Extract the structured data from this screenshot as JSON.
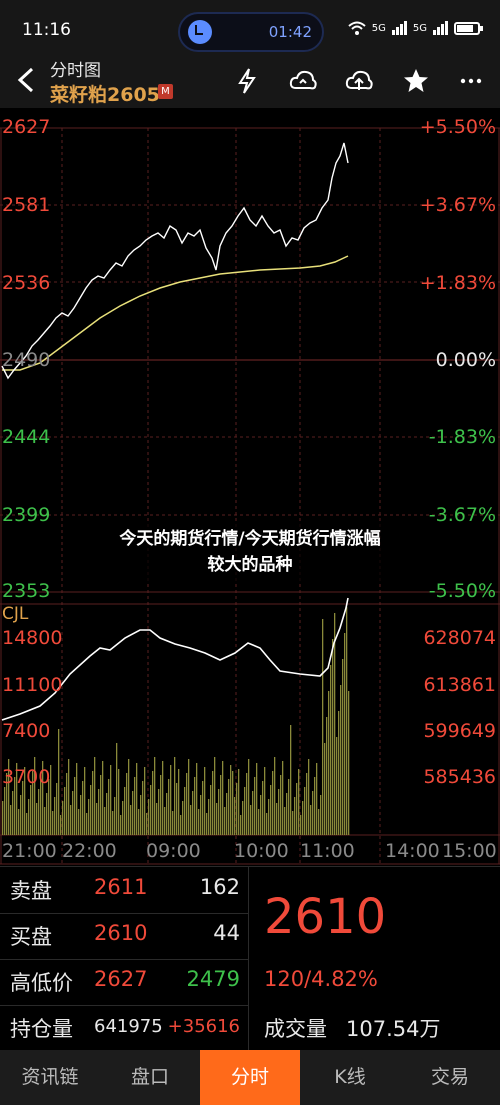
{
  "status_bar": {
    "time": "11:16",
    "timer": "01:42",
    "net1": "5G",
    "net2": "5G"
  },
  "header": {
    "subtitle": "分时图",
    "title": "菜籽粕2605",
    "badge": "M"
  },
  "chart": {
    "price_labels": [
      "2627",
      "2581",
      "2536",
      "2490",
      "2444",
      "2399",
      "2353"
    ],
    "pct_labels": [
      "+5.50%",
      "+3.67%",
      "+1.83%",
      "0.00%",
      "-1.83%",
      "-3.67%",
      "-5.50%"
    ],
    "vol_indicator": "CJL",
    "vol_left": [
      "14800",
      "11100",
      "7400",
      "3700"
    ],
    "vol_right": [
      "628074",
      "613861",
      "599649",
      "585436"
    ],
    "time_labels": [
      "21:00",
      "22:00",
      "09:00",
      "10:00",
      "11:00",
      "14:00",
      "15:00"
    ],
    "colors": {
      "price_line": "#ffffff",
      "avg_line": "#e8e07a",
      "volume_bar": "#8a8a3a",
      "up": "#f04a3a",
      "down": "#3ec14b"
    }
  },
  "overlay": {
    "line1": "今天的期货行情/今天期货行情涨幅",
    "line2": "较大的品种"
  },
  "info": {
    "sell": {
      "label": "卖盘",
      "price": "2611",
      "qty": "162"
    },
    "buy": {
      "label": "买盘",
      "price": "2610",
      "qty": "44"
    },
    "hilo": {
      "label": "高低价",
      "high": "2627",
      "low": "2479"
    },
    "oi": {
      "label": "持仓量",
      "value": "641975",
      "change": "+35616"
    },
    "last_price": "2610",
    "change": "120/4.82%",
    "volume_label": "成交量",
    "volume_value": "107.54万"
  },
  "tabs": [
    {
      "label": "资讯链",
      "active": false
    },
    {
      "label": "盘口",
      "active": false
    },
    {
      "label": "分时",
      "active": true
    },
    {
      "label": "K线",
      "active": false
    },
    {
      "label": "交易",
      "active": false
    }
  ]
}
